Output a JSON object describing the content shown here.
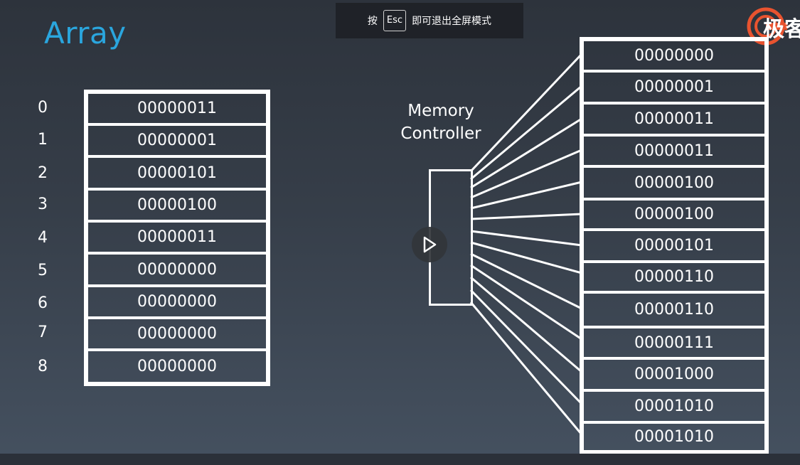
{
  "slide": {
    "title": "Array"
  },
  "esc_banner": {
    "prefix": "按",
    "key": "Esc",
    "suffix": "即可退出全屏模式"
  },
  "logo": {
    "text": "极客",
    "brand_color": "#e8532f"
  },
  "array": {
    "indices": [
      "0",
      "1",
      "2",
      "3",
      "4",
      "5",
      "6",
      "7",
      "8"
    ],
    "values": [
      "00000011",
      "00000001",
      "00000101",
      "00000100",
      "00000011",
      "00000000",
      "00000000",
      "00000000",
      "00000000"
    ]
  },
  "controller": {
    "line1": "Memory",
    "line2": "Controller"
  },
  "memory": {
    "values": [
      "00000000",
      "00000001",
      "00000011",
      "00000011",
      "00000100",
      "00000100",
      "00000101",
      "00000110",
      "00000110",
      "00000111",
      "00001000",
      "00001010",
      "00001010"
    ]
  },
  "colors": {
    "title": "#2aa6de",
    "line": "#ffffff",
    "background": "#353c47"
  },
  "player": {
    "icon": "play-icon"
  }
}
